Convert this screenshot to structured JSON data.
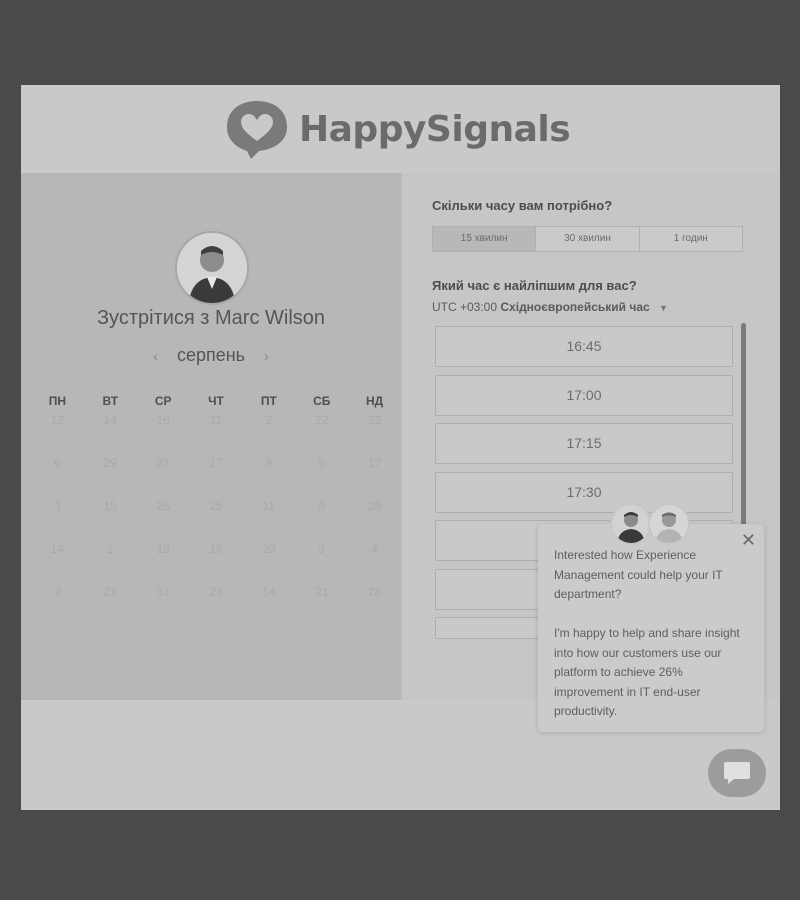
{
  "brand": {
    "name": "HappySignals"
  },
  "calendar": {
    "meet_title": "Зустрітися з Marc Wilson",
    "month": "серпень",
    "prev_icon": "chevron-left-icon",
    "next_icon": "chevron-right-icon",
    "weekdays": [
      "ПН",
      "ВТ",
      "СР",
      "ЧТ",
      "ПТ",
      "СБ",
      "НД"
    ],
    "weeks": [
      [
        "12",
        "14",
        "16",
        "11",
        "2",
        "22",
        "22"
      ],
      [
        "6",
        "29",
        "27",
        "17",
        "9",
        "5",
        "17"
      ],
      [
        "3",
        "15",
        "26",
        "25",
        "11",
        "8",
        "28"
      ],
      [
        "14",
        "1",
        "13",
        "16",
        "23",
        "3",
        "4"
      ],
      [
        "2",
        "21",
        "31",
        "24",
        "14",
        "21",
        "28"
      ]
    ]
  },
  "booking": {
    "duration_question": "Скільки часу вам потрібно?",
    "durations": [
      "15 хвилин",
      "30 хвилин",
      "1 годин"
    ],
    "selected_duration": "15 хвилин",
    "time_question": "Який час є найліпшим для вас?",
    "timezone_offset": "UTC +03:00",
    "timezone_name": "Східноєвропейський час",
    "slots": [
      "16:45",
      "17:00",
      "17:15",
      "17:30",
      "",
      "",
      ""
    ]
  },
  "chat_popup": {
    "paragraph1": "Interested how Experience Management could help your IT department?",
    "paragraph2": "I'm happy to help and share insight into how our customers use our platform to achieve 26% improvement in IT end-user productivity.",
    "close_icon": "close-icon",
    "launcher_icon": "chat-bubble-icon"
  },
  "colors": {
    "page_background": "#4a4a4a",
    "panel_left": "#b7b7b7",
    "panel_right": "#c6c6c6"
  }
}
